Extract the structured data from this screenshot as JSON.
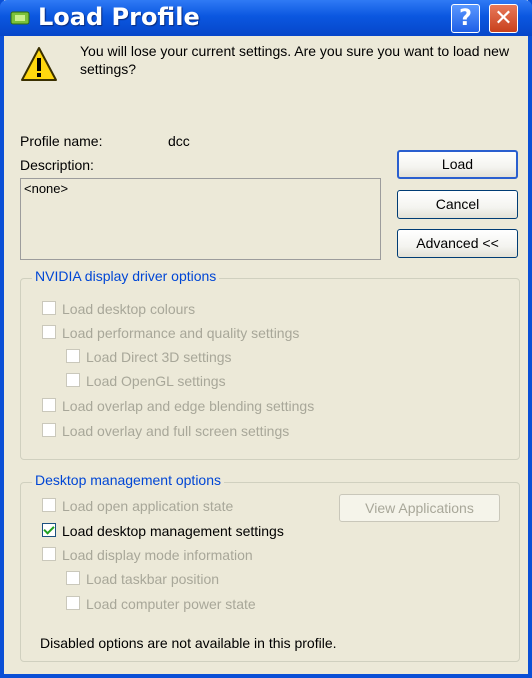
{
  "window": {
    "title": "Load Profile",
    "help_glyph": "?",
    "close_glyph": "✕"
  },
  "colors": {
    "titlebar": "#0b57e0",
    "group_legend": "#0046d5",
    "disabled_text": "#a8a799"
  },
  "icons": {
    "app": "monitor-icon",
    "warning": "warning-icon",
    "help": "help-icon",
    "close": "close-icon"
  },
  "message": "You will lose your current settings. Are you sure you want to load new settings?",
  "profile": {
    "name_label": "Profile name:",
    "name_value": "dcc",
    "description_label": "Description:",
    "description_value": "<none>"
  },
  "buttons": {
    "load": "Load",
    "cancel": "Cancel",
    "advanced": "Advanced <<",
    "view_applications": "View Applications"
  },
  "nvidia_group": {
    "legend": "NVIDIA display driver options",
    "options": [
      {
        "label": "Load desktop colours",
        "checked": false,
        "enabled": false
      },
      {
        "label": "Load performance and quality settings",
        "checked": false,
        "enabled": false
      },
      {
        "label": "Load Direct 3D settings",
        "checked": false,
        "enabled": false
      },
      {
        "label": "Load OpenGL settings",
        "checked": false,
        "enabled": false
      },
      {
        "label": "Load overlap and edge blending settings",
        "checked": false,
        "enabled": false
      },
      {
        "label": "Load overlay and full screen settings",
        "checked": false,
        "enabled": false
      }
    ]
  },
  "desktop_group": {
    "legend": "Desktop management options",
    "options": [
      {
        "label": "Load open application state",
        "checked": false,
        "enabled": false
      },
      {
        "label": "Load desktop management settings",
        "checked": true,
        "enabled": true
      },
      {
        "label": "Load display mode information",
        "checked": false,
        "enabled": false
      },
      {
        "label": "Load taskbar position",
        "checked": false,
        "enabled": false
      },
      {
        "label": "Load computer power state",
        "checked": false,
        "enabled": false
      }
    ],
    "note": "Disabled options are not available in this profile."
  }
}
